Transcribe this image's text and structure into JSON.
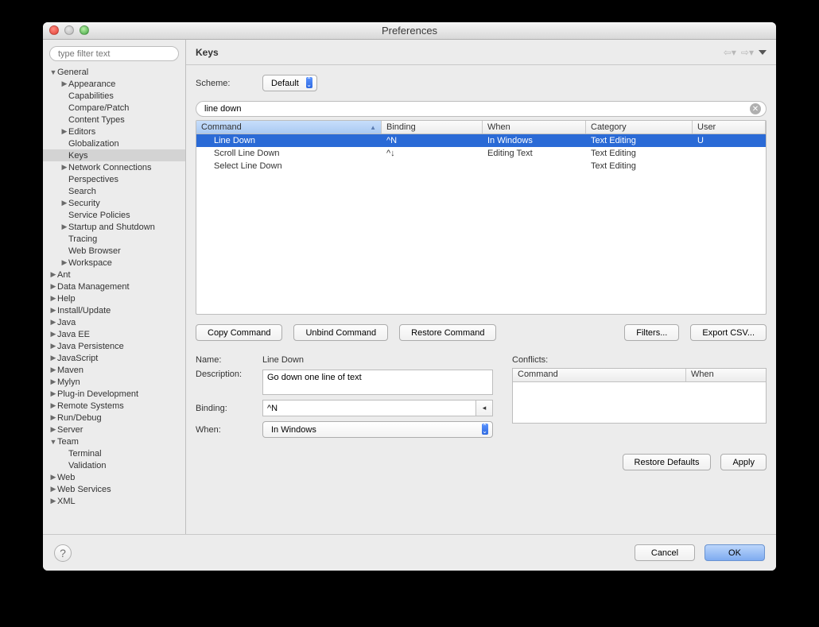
{
  "window": {
    "title": "Preferences"
  },
  "sidebar": {
    "filter_placeholder": "type filter text",
    "tree": [
      {
        "label": "General",
        "depth": 0,
        "expanded": true,
        "hasChildren": true
      },
      {
        "label": "Appearance",
        "depth": 1,
        "expanded": false,
        "hasChildren": true
      },
      {
        "label": "Capabilities",
        "depth": 1,
        "hasChildren": false
      },
      {
        "label": "Compare/Patch",
        "depth": 1,
        "hasChildren": false
      },
      {
        "label": "Content Types",
        "depth": 1,
        "hasChildren": false
      },
      {
        "label": "Editors",
        "depth": 1,
        "expanded": false,
        "hasChildren": true
      },
      {
        "label": "Globalization",
        "depth": 1,
        "hasChildren": false
      },
      {
        "label": "Keys",
        "depth": 1,
        "hasChildren": false,
        "selected": true
      },
      {
        "label": "Network Connections",
        "depth": 1,
        "expanded": false,
        "hasChildren": true
      },
      {
        "label": "Perspectives",
        "depth": 1,
        "hasChildren": false
      },
      {
        "label": "Search",
        "depth": 1,
        "hasChildren": false
      },
      {
        "label": "Security",
        "depth": 1,
        "expanded": false,
        "hasChildren": true
      },
      {
        "label": "Service Policies",
        "depth": 1,
        "hasChildren": false
      },
      {
        "label": "Startup and Shutdown",
        "depth": 1,
        "expanded": false,
        "hasChildren": true
      },
      {
        "label": "Tracing",
        "depth": 1,
        "hasChildren": false
      },
      {
        "label": "Web Browser",
        "depth": 1,
        "hasChildren": false
      },
      {
        "label": "Workspace",
        "depth": 1,
        "expanded": false,
        "hasChildren": true
      },
      {
        "label": "Ant",
        "depth": 0,
        "expanded": false,
        "hasChildren": true
      },
      {
        "label": "Data Management",
        "depth": 0,
        "expanded": false,
        "hasChildren": true
      },
      {
        "label": "Help",
        "depth": 0,
        "expanded": false,
        "hasChildren": true
      },
      {
        "label": "Install/Update",
        "depth": 0,
        "expanded": false,
        "hasChildren": true
      },
      {
        "label": "Java",
        "depth": 0,
        "expanded": false,
        "hasChildren": true
      },
      {
        "label": "Java EE",
        "depth": 0,
        "expanded": false,
        "hasChildren": true
      },
      {
        "label": "Java Persistence",
        "depth": 0,
        "expanded": false,
        "hasChildren": true
      },
      {
        "label": "JavaScript",
        "depth": 0,
        "expanded": false,
        "hasChildren": true
      },
      {
        "label": "Maven",
        "depth": 0,
        "expanded": false,
        "hasChildren": true
      },
      {
        "label": "Mylyn",
        "depth": 0,
        "expanded": false,
        "hasChildren": true
      },
      {
        "label": "Plug-in Development",
        "depth": 0,
        "expanded": false,
        "hasChildren": true
      },
      {
        "label": "Remote Systems",
        "depth": 0,
        "expanded": false,
        "hasChildren": true
      },
      {
        "label": "Run/Debug",
        "depth": 0,
        "expanded": false,
        "hasChildren": true
      },
      {
        "label": "Server",
        "depth": 0,
        "expanded": false,
        "hasChildren": true
      },
      {
        "label": "Team",
        "depth": 0,
        "expanded": true,
        "hasChildren": true
      },
      {
        "label": "Terminal",
        "depth": 1,
        "hasChildren": false
      },
      {
        "label": "Validation",
        "depth": 1,
        "hasChildren": false
      },
      {
        "label": "Web",
        "depth": 0,
        "expanded": false,
        "hasChildren": true
      },
      {
        "label": "Web Services",
        "depth": 0,
        "expanded": false,
        "hasChildren": true
      },
      {
        "label": "XML",
        "depth": 0,
        "expanded": false,
        "hasChildren": true
      }
    ]
  },
  "page": {
    "title": "Keys",
    "scheme_label": "Scheme:",
    "scheme_value": "Default",
    "search_value": "line down",
    "columns": {
      "command": "Command",
      "binding": "Binding",
      "when": "When",
      "category": "Category",
      "user": "User"
    },
    "rows": [
      {
        "command": "Line Down",
        "binding": "^N",
        "when": "In Windows",
        "category": "Text Editing",
        "user": "U",
        "selected": true
      },
      {
        "command": "Scroll Line Down",
        "binding": "^↓",
        "when": "Editing Text",
        "category": "Text Editing",
        "user": ""
      },
      {
        "command": "Select Line Down",
        "binding": "",
        "when": "",
        "category": "Text Editing",
        "user": ""
      }
    ],
    "buttons": {
      "copy": "Copy Command",
      "unbind": "Unbind Command",
      "restore": "Restore Command",
      "filters": "Filters...",
      "export": "Export CSV..."
    },
    "form": {
      "name_label": "Name:",
      "name_value": "Line Down",
      "desc_label": "Description:",
      "desc_value": "Go down one line of text",
      "binding_label": "Binding:",
      "binding_value": "^N",
      "when_label": "When:",
      "when_value": "In Windows",
      "conflicts_label": "Conflicts:",
      "conflict_cols": {
        "command": "Command",
        "when": "When"
      }
    },
    "restore_defaults": "Restore Defaults",
    "apply": "Apply"
  },
  "footer": {
    "cancel": "Cancel",
    "ok": "OK"
  }
}
